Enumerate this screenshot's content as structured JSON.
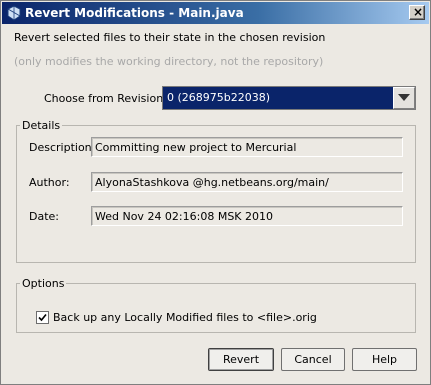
{
  "window": {
    "title": "Revert Modifications - Main.java",
    "close_glyph": "×"
  },
  "intro": {
    "line1": "Revert selected files to their state in the chosen revision",
    "line2": "(only modifies the working directory, not the repository)"
  },
  "revisions": {
    "label": "Choose from Revisions:",
    "selected": "0 (268975b22038)"
  },
  "details": {
    "title": "Details",
    "description_label": "Description:",
    "description_value": "Committing new project to Mercurial",
    "author_label": "Author:",
    "author_value": "AlyonaStashkova @hg.netbeans.org/main/",
    "date_label": "Date:",
    "date_value": "Wed Nov 24 02:16:08 MSK 2010"
  },
  "options": {
    "title": "Options",
    "backup_label": "Back up any Locally Modified files to <file>.orig",
    "backup_checked": true
  },
  "buttons": {
    "revert": "Revert",
    "cancel": "Cancel",
    "help": "Help"
  },
  "colors": {
    "titlebar": "#0a246a",
    "selection": "#0a246a",
    "muted_text": "#a8a8a8"
  }
}
